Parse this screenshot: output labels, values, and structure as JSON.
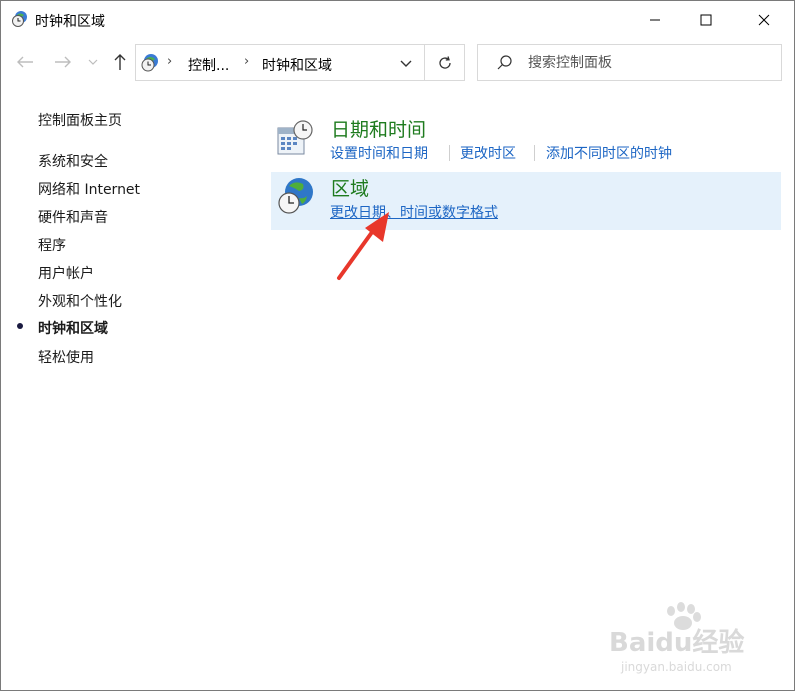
{
  "window": {
    "title": "时钟和区域"
  },
  "titlebar": {
    "minimize_icon": "minimize-icon",
    "maximize_icon": "maximize-icon",
    "close_icon": "close-icon"
  },
  "nav": {
    "back_icon": "arrow-left-icon",
    "forward_icon": "arrow-right-icon",
    "recent_icon": "chevron-down-icon",
    "up_icon": "arrow-up-icon"
  },
  "address": {
    "crumbs": [
      "控制...",
      "时钟和区域"
    ]
  },
  "search": {
    "placeholder": "搜索控制面板"
  },
  "sidebar": {
    "home": "控制面板主页",
    "items": [
      {
        "label": "系统和安全"
      },
      {
        "label": "网络和 Internet"
      },
      {
        "label": "硬件和声音"
      },
      {
        "label": "程序"
      },
      {
        "label": "用户帐户"
      },
      {
        "label": "外观和个性化"
      },
      {
        "label": "时钟和区域",
        "active": true
      },
      {
        "label": "轻松使用"
      }
    ]
  },
  "categories": [
    {
      "title": "日期和时间",
      "icon": "calendar-clock-icon",
      "links": [
        "设置时间和日期",
        "更改时区",
        "添加不同时区的时钟"
      ]
    },
    {
      "title": "区域",
      "icon": "globe-clock-icon",
      "links": [
        "更改日期、时间或数字格式"
      ]
    }
  ],
  "annotation": {
    "arrow_color": "#e8372b"
  },
  "watermark": {
    "brand": "Baidu经验",
    "url": "jingyan.baidu.com"
  }
}
